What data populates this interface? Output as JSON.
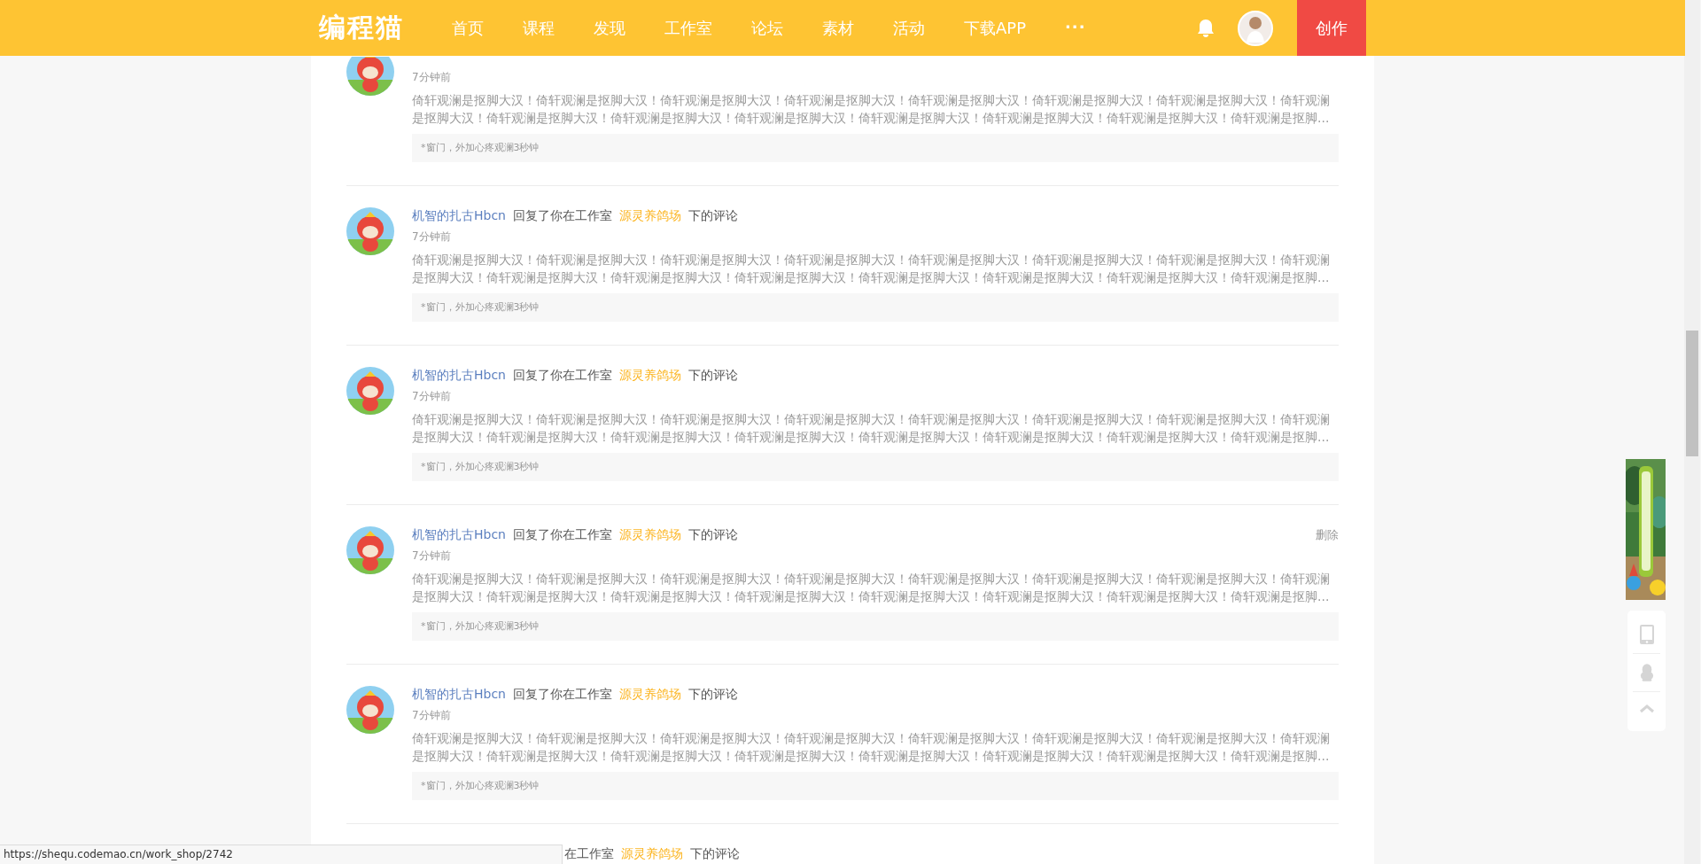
{
  "header": {
    "logo": "编程猫",
    "nav": [
      {
        "label": "首页",
        "kind": "link"
      },
      {
        "label": "课程",
        "kind": "link"
      },
      {
        "label": "发现",
        "kind": "link"
      },
      {
        "label": "工作室",
        "kind": "link"
      },
      {
        "label": "论坛",
        "kind": "link"
      },
      {
        "label": "素材",
        "kind": "link"
      },
      {
        "label": "活动",
        "kind": "link"
      },
      {
        "label": "下载APP",
        "kind": "link"
      },
      {
        "label": "···",
        "kind": "more"
      }
    ],
    "create_button": "创作"
  },
  "comments": [
    {
      "kind": "topcut",
      "time": "7分钟前",
      "body": "倚轩观澜是抠脚大汉！倚轩观澜是抠脚大汉！倚轩观澜是抠脚大汉！倚轩观澜是抠脚大汉！倚轩观澜是抠脚大汉！倚轩观澜是抠脚大汉！倚轩观澜是抠脚大汉！倚轩观澜是抠脚大汉！倚轩观澜是抠脚大汉！倚轩观澜是抠脚大汉！倚轩观澜是抠脚大汉！倚轩观澜是抠脚大汉！倚轩观澜是抠脚大汉！倚轩观澜是抠脚大汉！倚轩观澜是抠脚...",
      "quote": "*窗门，外加心疼观澜3秒钟"
    },
    {
      "kind": "full",
      "user": "机智的扎古Hbcn",
      "action": "回复了你在工作室",
      "studio": "源灵养鸽场",
      "suffix": "下的评论",
      "time": "7分钟前",
      "body": "倚轩观澜是抠脚大汉！倚轩观澜是抠脚大汉！倚轩观澜是抠脚大汉！倚轩观澜是抠脚大汉！倚轩观澜是抠脚大汉！倚轩观澜是抠脚大汉！倚轩观澜是抠脚大汉！倚轩观澜是抠脚大汉！倚轩观澜是抠脚大汉！倚轩观澜是抠脚大汉！倚轩观澜是抠脚大汉！倚轩观澜是抠脚大汉！倚轩观澜是抠脚大汉！倚轩观澜是抠脚大汉！倚轩观澜是抠脚...",
      "quote": "*窗门，外加心疼观澜3秒钟"
    },
    {
      "kind": "full",
      "user": "机智的扎古Hbcn",
      "action": "回复了你在工作室",
      "studio": "源灵养鸽场",
      "suffix": "下的评论",
      "time": "7分钟前",
      "body": "倚轩观澜是抠脚大汉！倚轩观澜是抠脚大汉！倚轩观澜是抠脚大汉！倚轩观澜是抠脚大汉！倚轩观澜是抠脚大汉！倚轩观澜是抠脚大汉！倚轩观澜是抠脚大汉！倚轩观澜是抠脚大汉！倚轩观澜是抠脚大汉！倚轩观澜是抠脚大汉！倚轩观澜是抠脚大汉！倚轩观澜是抠脚大汉！倚轩观澜是抠脚大汉！倚轩观澜是抠脚大汉！倚轩观澜是抠脚...",
      "quote": "*窗门，外加心疼观澜3秒钟"
    },
    {
      "kind": "full",
      "user": "机智的扎古Hbcn",
      "action": "回复了你在工作室",
      "studio": "源灵养鸽场",
      "suffix": "下的评论",
      "time": "7分钟前",
      "delete_link": "删除",
      "body": "倚轩观澜是抠脚大汉！倚轩观澜是抠脚大汉！倚轩观澜是抠脚大汉！倚轩观澜是抠脚大汉！倚轩观澜是抠脚大汉！倚轩观澜是抠脚大汉！倚轩观澜是抠脚大汉！倚轩观澜是抠脚大汉！倚轩观澜是抠脚大汉！倚轩观澜是抠脚大汉！倚轩观澜是抠脚大汉！倚轩观澜是抠脚大汉！倚轩观澜是抠脚大汉！倚轩观澜是抠脚大汉！倚轩观澜是抠脚...",
      "quote": "*窗门，外加心疼观澜3秒钟"
    },
    {
      "kind": "full",
      "user": "机智的扎古Hbcn",
      "action": "回复了你在工作室",
      "studio": "源灵养鸽场",
      "suffix": "下的评论",
      "time": "7分钟前",
      "body": "倚轩观澜是抠脚大汉！倚轩观澜是抠脚大汉！倚轩观澜是抠脚大汉！倚轩观澜是抠脚大汉！倚轩观澜是抠脚大汉！倚轩观澜是抠脚大汉！倚轩观澜是抠脚大汉！倚轩观澜是抠脚大汉！倚轩观澜是抠脚大汉！倚轩观澜是抠脚大汉！倚轩观澜是抠脚大汉！倚轩观澜是抠脚大汉！倚轩观澜是抠脚大汉！倚轩观澜是抠脚大汉！倚轩观澜是抠脚...",
      "quote": "*窗门，外加心疼观澜3秒钟"
    },
    {
      "kind": "partial",
      "action": "在工作室",
      "studio": "源灵养鸽场",
      "suffix": "下的评论"
    }
  ],
  "status_url": "https://shequ.codemao.cn/work_shop/2742"
}
